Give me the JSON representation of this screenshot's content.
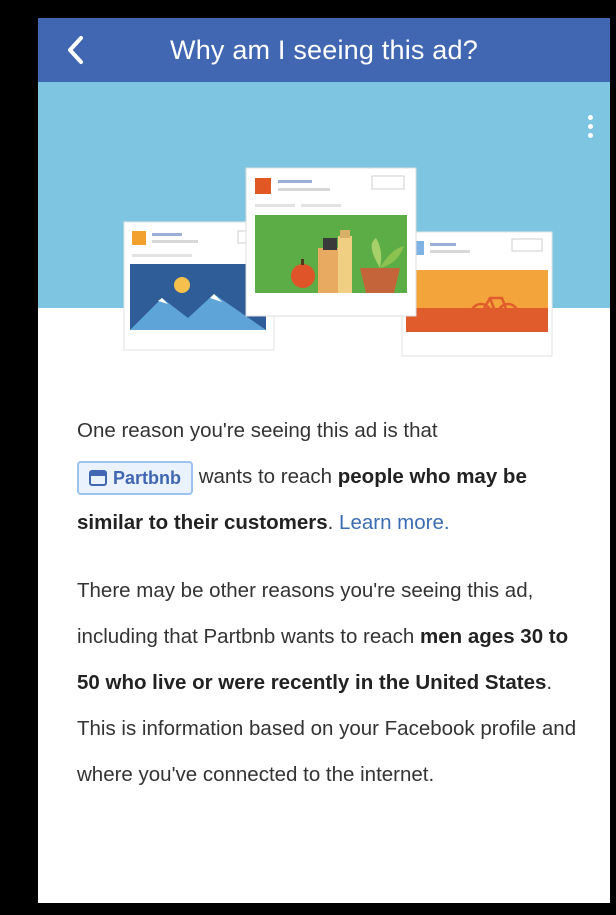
{
  "header": {
    "title": "Why am I seeing this ad?",
    "back_icon": "chevron-left-icon",
    "background": "#4267b2"
  },
  "hero": {
    "background": "#7ec5e2",
    "menu_icon": "more-vertical-icon"
  },
  "reason1": {
    "text_before": "One reason you're seeing this ad is that",
    "advertiser_chip": "Partbnb",
    "advertiser_icon": "storefront-icon",
    "text_middle": "wants to reach",
    "bold": "people who may be similar to their customers",
    "text_after": ".",
    "learn_more": "Learn more."
  },
  "reason2": {
    "text_before": "There may be other reasons you're seeing this ad, including that Partbnb wants to reach",
    "bold": "men ages 30 to 50 who live or were recently in the United States",
    "text_after": ". This is information based on your Facebook profile and where you've connected to the internet."
  }
}
